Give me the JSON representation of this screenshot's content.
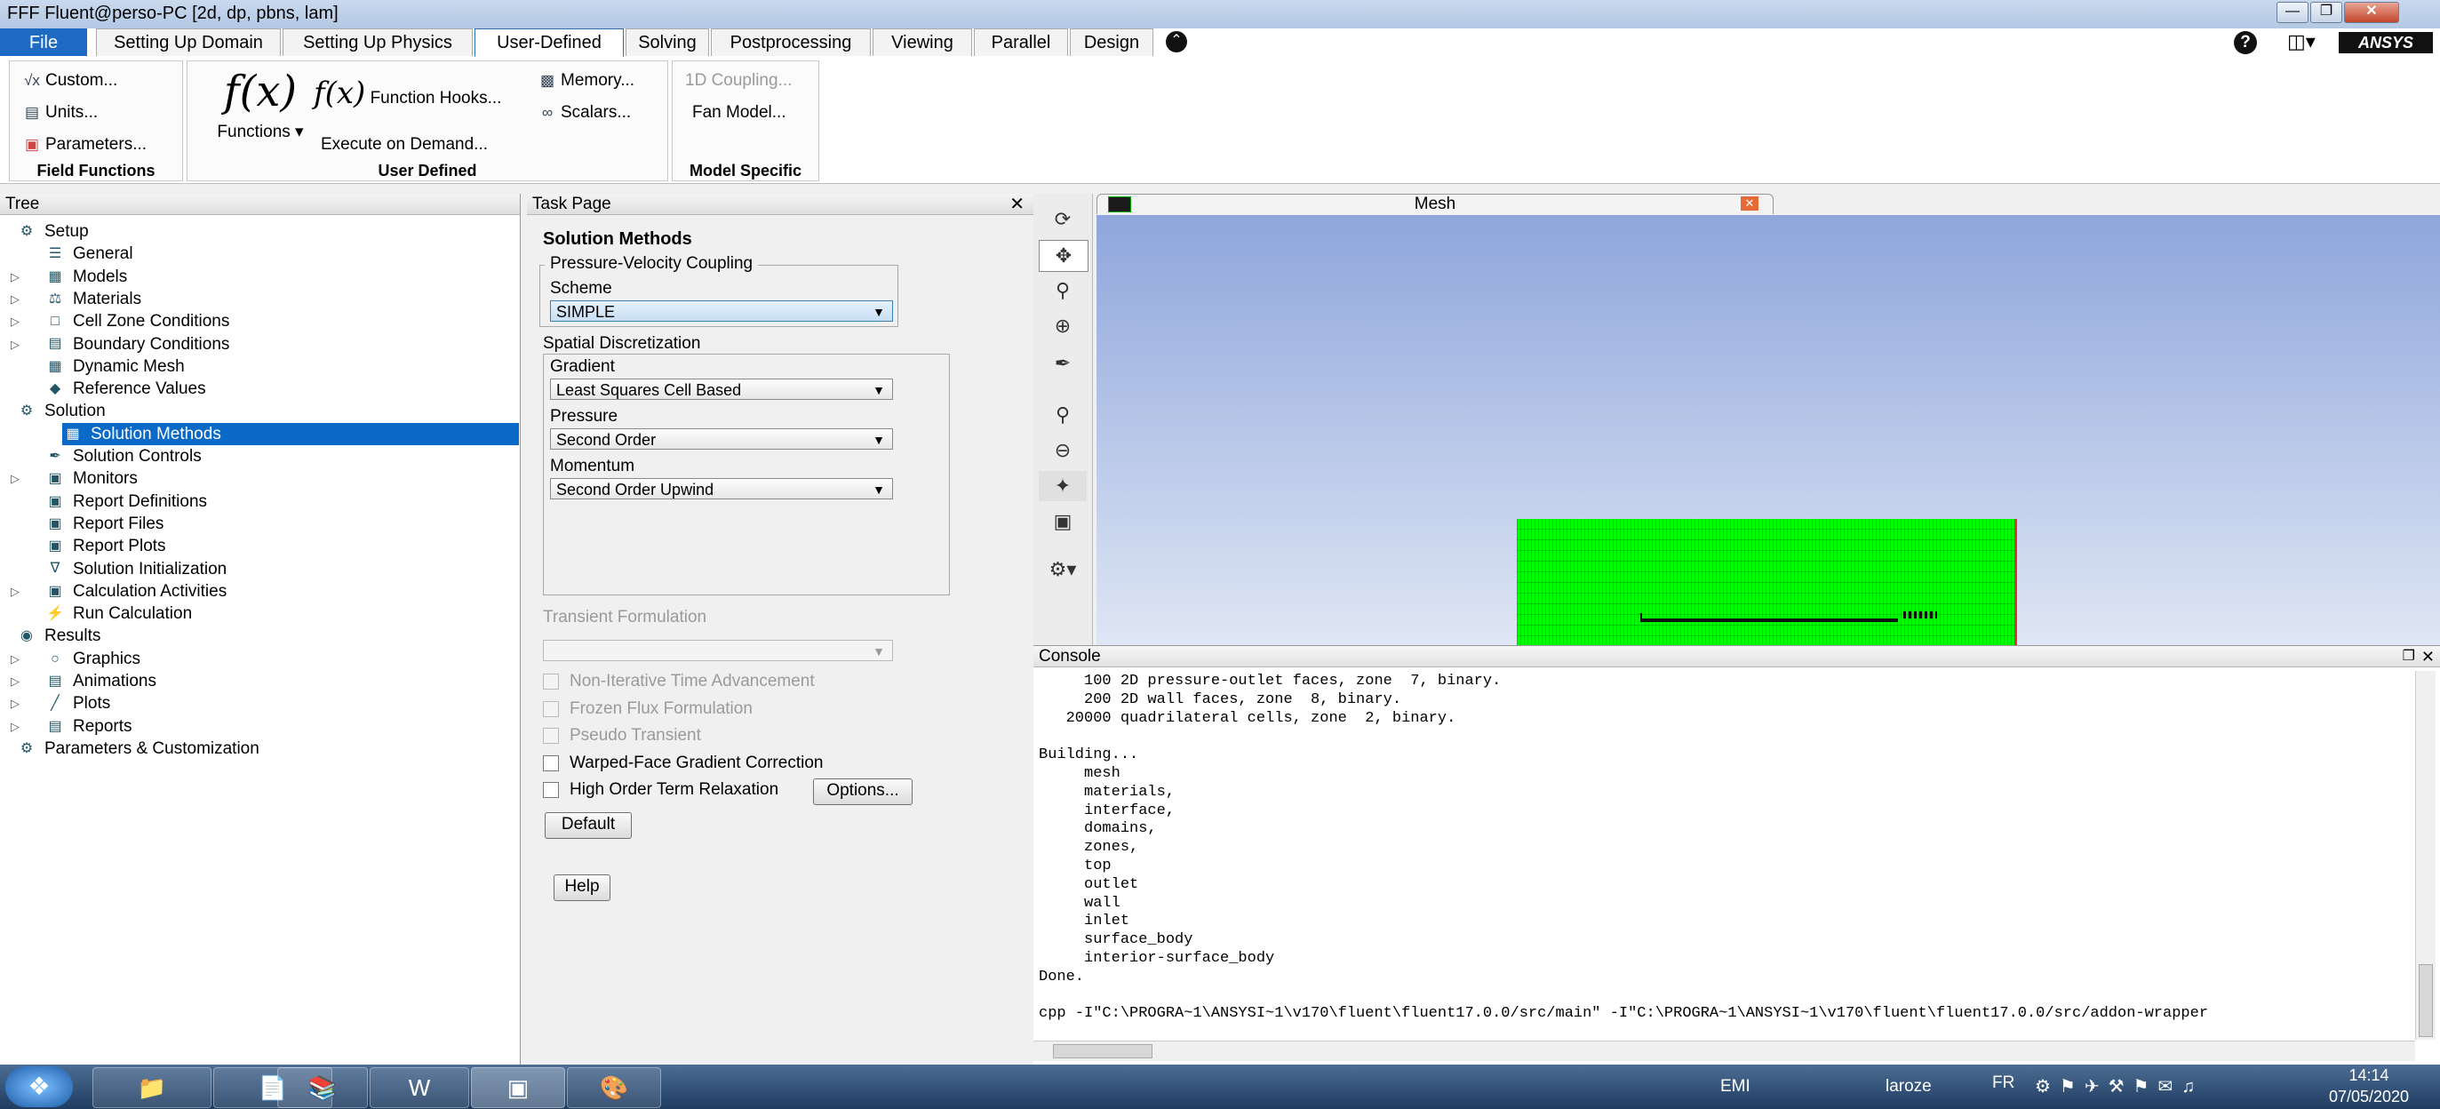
{
  "window": {
    "title": "FFF Fluent@perso-PC  [2d, dp, pbns, lam]"
  },
  "menu_tabs": [
    "File",
    "Setting Up Domain",
    "Setting Up Physics",
    "User-Defined",
    "Solving",
    "Postprocessing",
    "Viewing",
    "Parallel",
    "Design"
  ],
  "active_tab": "User-Defined",
  "brand": "ANSYS",
  "ribbon": {
    "field_functions": {
      "title": "Field Functions",
      "items": [
        "Custom...",
        "Units...",
        "Parameters..."
      ]
    },
    "user_defined": {
      "title": "User Defined",
      "functions_label": "Functions",
      "function_hooks": "Function Hooks...",
      "execute_on_demand": "Execute on Demand...",
      "memory": "Memory...",
      "scalars": "Scalars..."
    },
    "model_specific": {
      "title": "Model Specific",
      "coupling": "1D Coupling...",
      "fan_model": "Fan Model..."
    }
  },
  "tree": {
    "header": "Tree",
    "items": [
      {
        "label": "Setup",
        "level": 0,
        "exp": "open",
        "icon": "setup-icon"
      },
      {
        "label": "General",
        "level": 1,
        "exp": "",
        "icon": "general-icon"
      },
      {
        "label": "Models",
        "level": 1,
        "exp": "closed",
        "icon": "models-icon"
      },
      {
        "label": "Materials",
        "level": 1,
        "exp": "closed",
        "icon": "materials-icon"
      },
      {
        "label": "Cell Zone Conditions",
        "level": 1,
        "exp": "closed",
        "icon": "cell-zone-icon"
      },
      {
        "label": "Boundary Conditions",
        "level": 1,
        "exp": "closed",
        "icon": "boundary-icon"
      },
      {
        "label": "Dynamic Mesh",
        "level": 1,
        "exp": "",
        "icon": "dynamic-mesh-icon"
      },
      {
        "label": "Reference Values",
        "level": 1,
        "exp": "",
        "icon": "reference-icon"
      },
      {
        "label": "Solution",
        "level": 0,
        "exp": "open",
        "icon": "solution-icon"
      },
      {
        "label": "Solution Methods",
        "level": 1,
        "exp": "",
        "icon": "methods-icon",
        "selected": true
      },
      {
        "label": "Solution Controls",
        "level": 1,
        "exp": "",
        "icon": "controls-icon"
      },
      {
        "label": "Monitors",
        "level": 1,
        "exp": "closed",
        "icon": "monitors-icon"
      },
      {
        "label": "Report Definitions",
        "level": 1,
        "exp": "",
        "icon": "report-def-icon"
      },
      {
        "label": "Report Files",
        "level": 1,
        "exp": "",
        "icon": "report-files-icon"
      },
      {
        "label": "Report Plots",
        "level": 1,
        "exp": "",
        "icon": "report-plots-icon"
      },
      {
        "label": "Solution Initialization",
        "level": 1,
        "exp": "",
        "icon": "initialization-icon"
      },
      {
        "label": "Calculation Activities",
        "level": 1,
        "exp": "closed",
        "icon": "calc-activities-icon"
      },
      {
        "label": "Run Calculation",
        "level": 1,
        "exp": "",
        "icon": "run-icon"
      },
      {
        "label": "Results",
        "level": 0,
        "exp": "open",
        "icon": "results-icon"
      },
      {
        "label": "Graphics",
        "level": 1,
        "exp": "closed",
        "icon": "graphics-icon"
      },
      {
        "label": "Animations",
        "level": 1,
        "exp": "closed",
        "icon": "animations-icon"
      },
      {
        "label": "Plots",
        "level": 1,
        "exp": "closed",
        "icon": "plots-icon"
      },
      {
        "label": "Reports",
        "level": 1,
        "exp": "closed",
        "icon": "reports-icon"
      },
      {
        "label": "Parameters & Customization",
        "level": 0,
        "exp": "closed",
        "icon": "parameters-icon"
      }
    ]
  },
  "task": {
    "header": "Task Page",
    "title": "Solution Methods",
    "pv_coupling_label": "Pressure-Velocity Coupling",
    "scheme_label": "Scheme",
    "scheme_value": "SIMPLE",
    "spatial_label": "Spatial Discretization",
    "gradient_label": "Gradient",
    "gradient_value": "Least Squares Cell Based",
    "pressure_label": "Pressure",
    "pressure_value": "Second Order",
    "momentum_label": "Momentum",
    "momentum_value": "Second Order Upwind",
    "transient_label": "Transient Formulation",
    "checkboxes": [
      {
        "label": "Non-Iterative Time Advancement",
        "enabled": false
      },
      {
        "label": "Frozen Flux Formulation",
        "enabled": false
      },
      {
        "label": "Pseudo Transient",
        "enabled": false
      },
      {
        "label": "Warped-Face Gradient Correction",
        "enabled": true
      },
      {
        "label": "High Order Term Relaxation",
        "enabled": true
      }
    ],
    "options_button": "Options...",
    "default_button": "Default",
    "help_button": "Help"
  },
  "graphics": {
    "tab_title": "Mesh"
  },
  "console": {
    "header": "Console",
    "lines": [
      "     100 2D pressure-outlet faces, zone  7, binary.",
      "     200 2D wall faces, zone  8, binary.",
      "   20000 quadrilateral cells, zone  2, binary.",
      "",
      "Building...",
      "     mesh",
      "     materials,",
      "     interface,",
      "     domains,",
      "     zones,",
      "     top",
      "     outlet",
      "     wall",
      "     inlet",
      "     surface_body",
      "     interior-surface_body",
      "Done.",
      "",
      "cpp -I\"C:\\PROGRA~1\\ANSYSI~1\\v170\\fluent\\fluent17.0.0/src/main\" -I\"C:\\PROGRA~1\\ANSYSI~1\\v170\\fluent\\fluent17.0.0/src/addon-wrapper"
    ]
  },
  "taskbar": {
    "lang1": "EMI",
    "user": "laroze",
    "lang2": "FR",
    "time": "14:14",
    "date": "07/05/2020"
  }
}
